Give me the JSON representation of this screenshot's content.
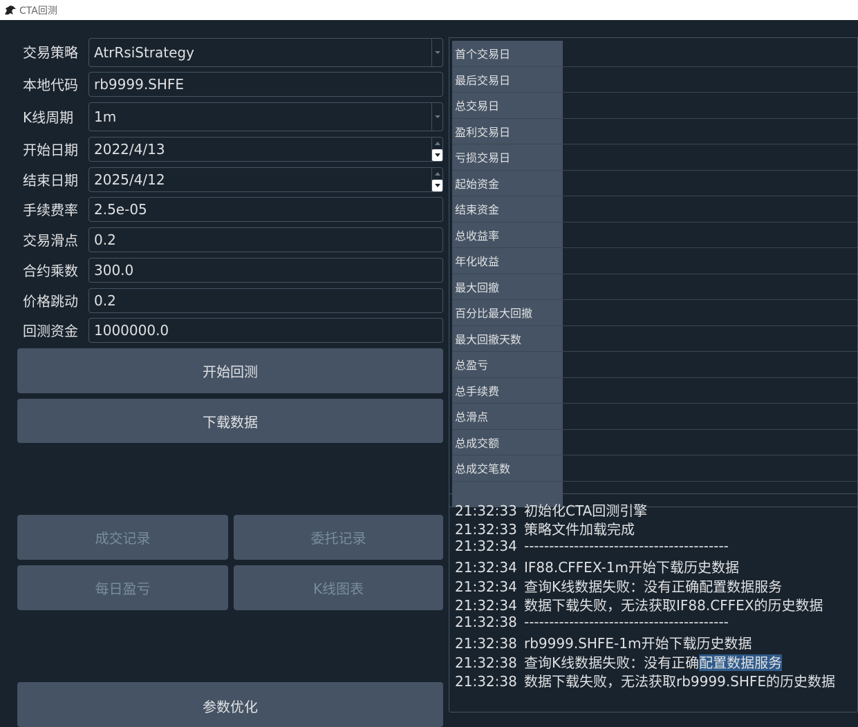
{
  "window": {
    "title": "CTA回测"
  },
  "form": {
    "strategy": {
      "label": "交易策略",
      "value": "AtrRsiStrategy"
    },
    "symbol": {
      "label": "本地代码",
      "value": "rb9999.SHFE"
    },
    "interval": {
      "label": "K线周期",
      "value": "1m"
    },
    "start": {
      "label": "开始日期",
      "value": "2022/4/13"
    },
    "end": {
      "label": "结束日期",
      "value": "2025/4/12"
    },
    "rate": {
      "label": "手续费率",
      "value": "2.5e-05"
    },
    "slippage": {
      "label": "交易滑点",
      "value": "0.2"
    },
    "size": {
      "label": "合约乘数",
      "value": "300.0"
    },
    "pricetick": {
      "label": "价格跳动",
      "value": "0.2"
    },
    "capital": {
      "label": "回测资金",
      "value": "1000000.0"
    }
  },
  "buttons": {
    "start_backtest": "开始回测",
    "download": "下载数据",
    "trades": "成交记录",
    "orders": "委托记录",
    "daily": "每日盈亏",
    "kline": "K线图表",
    "optimize": "参数优化"
  },
  "stats": [
    {
      "label": "首个交易日",
      "value": ""
    },
    {
      "label": "最后交易日",
      "value": ""
    },
    {
      "label": "总交易日",
      "value": ""
    },
    {
      "label": "盈利交易日",
      "value": ""
    },
    {
      "label": "亏损交易日",
      "value": ""
    },
    {
      "label": "起始资金",
      "value": ""
    },
    {
      "label": "结束资金",
      "value": ""
    },
    {
      "label": "总收益率",
      "value": ""
    },
    {
      "label": "年化收益",
      "value": ""
    },
    {
      "label": "最大回撤",
      "value": ""
    },
    {
      "label": "百分比最大回撤",
      "value": ""
    },
    {
      "label": "最大回撤天数",
      "value": ""
    },
    {
      "label": "总盈亏",
      "value": ""
    },
    {
      "label": "总手续费",
      "value": ""
    },
    {
      "label": "总滑点",
      "value": ""
    },
    {
      "label": "总成交额",
      "value": ""
    },
    {
      "label": "总成交笔数",
      "value": ""
    }
  ],
  "log": [
    {
      "time": "21:32:33",
      "msg": "初始化CTA回测引擎"
    },
    {
      "time": "21:32:33",
      "msg": "策略文件加载完成"
    },
    {
      "time": "21:32:34",
      "msg": "-----------------------------------------"
    },
    {
      "time": "21:32:34",
      "msg": "IF88.CFFEX-1m开始下载历史数据"
    },
    {
      "time": "21:32:34",
      "msg": "查询K线数据失败：没有正确配置数据服务"
    },
    {
      "time": "21:32:34",
      "msg": "数据下载失败，无法获取IF88.CFFEX的历史数据"
    },
    {
      "time": "21:32:38",
      "msg": "-----------------------------------------"
    },
    {
      "time": "21:32:38",
      "msg": "rb9999.SHFE-1m开始下载历史数据"
    },
    {
      "time": "21:32:38",
      "msg_pre": "查询K线数据失败：没有正确",
      "msg_hl": "配置数据服务"
    },
    {
      "time": "21:32:38",
      "msg": "数据下载失败，无法获取rb9999.SHFE的历史数据"
    }
  ]
}
